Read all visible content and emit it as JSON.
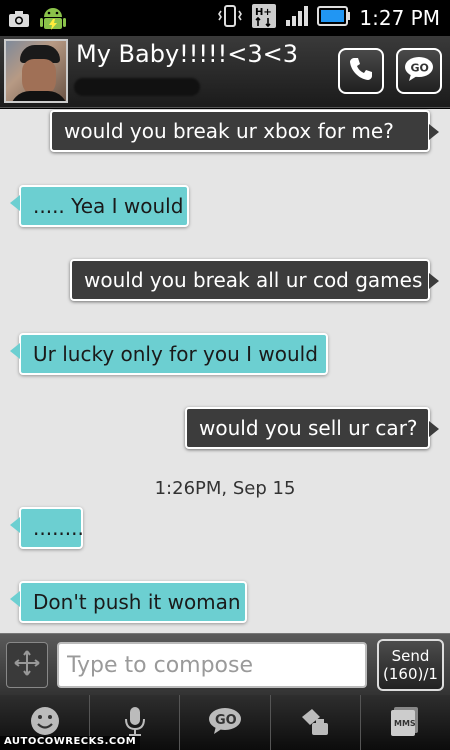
{
  "status_bar": {
    "time": "1:27 PM",
    "network_badge": "H+"
  },
  "contact": {
    "name": "My Baby!!!!!<3<3",
    "go_label": "GO"
  },
  "messages": [
    {
      "direction": "outgoing",
      "text": "would you break ur xbox for me?"
    },
    {
      "direction": "incoming",
      "text": "..... Yea I would"
    },
    {
      "direction": "outgoing",
      "text": "would you break all ur cod games"
    },
    {
      "direction": "incoming",
      "text": "Ur lucky only for you I would"
    },
    {
      "direction": "outgoing",
      "text": "would you sell ur car?"
    },
    {
      "direction": "incoming",
      "text": "........"
    },
    {
      "direction": "incoming",
      "text": "Don't push it woman"
    }
  ],
  "timestamp": "1:26PM, Sep 15",
  "compose": {
    "placeholder": "Type to compose",
    "send_label": "Send",
    "char_count": "(160)/1"
  },
  "toolbar": {
    "icons": [
      "smiley-icon",
      "microphone-icon",
      "go-icon",
      "paint-icon",
      "mms-icon"
    ],
    "mms_label": "MMS",
    "go_label": "GO"
  },
  "watermark": "AUTOCOWRECKS.COM",
  "colors": {
    "incoming_bubble": "#6ccfd1",
    "outgoing_bubble": "#3c3c3c",
    "conversation_bg": "#e5e5e5"
  }
}
